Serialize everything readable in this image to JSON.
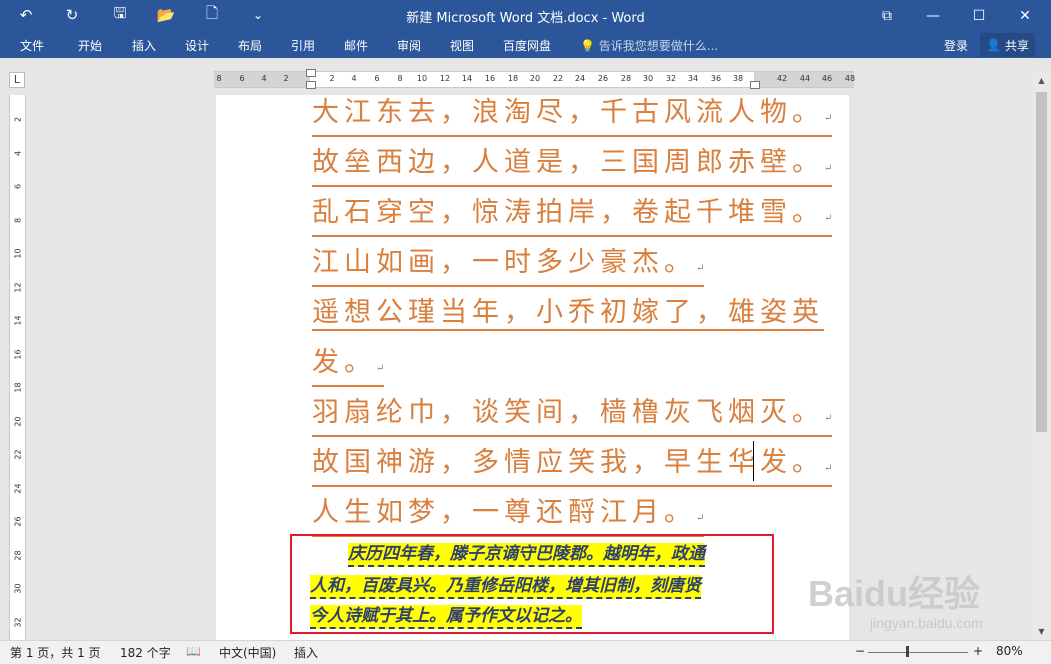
{
  "titlebar": {
    "title": "新建 Microsoft Word 文档.docx - Word",
    "undo_glyph": "↶",
    "redo_glyph": "↻",
    "save_glyph": "🖫",
    "open_glyph": "📂",
    "new_glyph": "🗋",
    "customize_glyph": "⌄",
    "ribbon_options_glyph": "⧉",
    "minimize_glyph": "—",
    "maximize_glyph": "☐",
    "close_glyph": "✕"
  },
  "menu": {
    "items": [
      "文件",
      "开始",
      "插入",
      "设计",
      "布局",
      "引用",
      "邮件",
      "审阅",
      "视图",
      "百度网盘"
    ],
    "tell_me": "告诉我您想要做什么...",
    "login": "登录",
    "share": "共享"
  },
  "ruler": {
    "corner": "L",
    "h_ticks": [
      "8",
      "6",
      "4",
      "2",
      "2",
      "4",
      "6",
      "8",
      "10",
      "12",
      "14",
      "16",
      "18",
      "20",
      "22",
      "24",
      "26",
      "28",
      "30",
      "32",
      "34",
      "36",
      "38",
      "42",
      "44",
      "46",
      "48"
    ],
    "v_ticks": [
      "2",
      "4",
      "6",
      "8",
      "10",
      "12",
      "14",
      "16",
      "18",
      "20",
      "22",
      "24",
      "26",
      "28",
      "30",
      "32"
    ]
  },
  "document": {
    "poem_lines": [
      "大江东去，浪淘尽，千古风流人物。",
      "故垒西边，人道是，三国周郎赤壁。",
      "乱石穿空，惊涛拍岸，卷起千堆雪。",
      "江山如画，一时多少豪杰。",
      "遥想公瑾当年，小乔初嫁了，雄姿英",
      "发。",
      "羽扇纶巾，谈笑间，樯橹灰飞烟灭。",
      "故国神游，多情应笑我，早生华发。",
      "人生如梦，一尊还酹江月。"
    ],
    "paragraph_mark": "↵",
    "prose_lines": [
      "庆历四年春，滕子京谪守巴陵郡。越明年，政通",
      "人和，百废具兴。乃重修岳阳楼，增其旧制，刻唐贤",
      "今人诗赋于其上。属予作文以记之。"
    ]
  },
  "statusbar": {
    "page": "第 1 页，共 1 页",
    "words": "182 个字",
    "proof_glyph": "📖",
    "language": "中文(中国)",
    "mode": "插入",
    "zoom_minus": "−",
    "zoom_plus": "+",
    "zoom": "80%"
  },
  "watermark": {
    "main": "Baidu经验",
    "sub": "jingyan.baidu.com"
  },
  "colors": {
    "brand": "#2b579a",
    "poem": "#d9803f",
    "highlight": "#ffff00",
    "box": "#e21b2a"
  }
}
